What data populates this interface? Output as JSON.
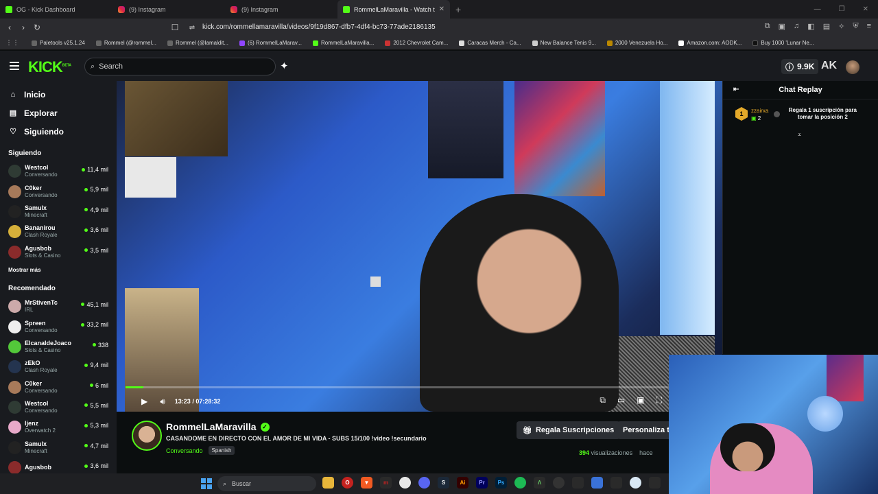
{
  "browser": {
    "tabs": [
      {
        "title": "OG - Kick Dashboard",
        "icon": "kick-icon"
      },
      {
        "title": "(9) Instagram",
        "icon": "instagram-icon"
      },
      {
        "title": "(9) Instagram",
        "icon": "instagram-icon"
      },
      {
        "title": "RommelLaMaravilla - Watch the",
        "icon": "kick-icon",
        "active": true
      }
    ],
    "url": "kick.com/rommellamaravilla/videos/9f19d867-dfb7-4df4-bc73-77ade2186135",
    "bookmarks": [
      "Paletools v25.1.24",
      "Rommel (@rommel...",
      "Rommel (@lamaldit...",
      "(6) RommelLaMarav...",
      "RommelLaMaravilla...",
      "2012 Chevrolet Cam...",
      "Caracas Merch - Ca...",
      "New Balance Tenis 9...",
      "2000 Venezuela Ho...",
      "Amazon.com: AODK...",
      "Buy 1000 'Lunar Ne..."
    ]
  },
  "header": {
    "logo": "KICK",
    "logo_beta": "BETA",
    "search_placeholder": "Search",
    "credits": "9.9K",
    "ak": "AK"
  },
  "sidebar": {
    "nav": [
      {
        "label": "Inicio",
        "icon": "home-icon"
      },
      {
        "label": "Explorar",
        "icon": "explore-icon"
      },
      {
        "label": "Siguiendo",
        "icon": "heart-icon"
      }
    ],
    "following_title": "Siguiendo",
    "following": [
      {
        "name": "Westcol",
        "category": "Conversando",
        "viewers": "11,4 mil",
        "color": "#2f3b34"
      },
      {
        "name": "C0ker",
        "category": "Conversando",
        "viewers": "5,9 mil",
        "color": "#a77a5a"
      },
      {
        "name": "Samulx",
        "category": "Minecraft",
        "viewers": "4,9 mil",
        "color": "#222"
      },
      {
        "name": "Bananirou",
        "category": "Clash Royale",
        "viewers": "3,6 mil",
        "color": "#d6b03a"
      },
      {
        "name": "Agusbob",
        "category": "Slots & Casino",
        "viewers": "3,5 mil",
        "color": "#8a2b2b"
      }
    ],
    "show_more": "Mostrar más",
    "recommended_title": "Recomendado",
    "recommended": [
      {
        "name": "MrStivenTc",
        "category": "IRL",
        "viewers": "45,1 mil",
        "color": "#caa"
      },
      {
        "name": "Spreen",
        "category": "Conversando",
        "viewers": "33,2 mil",
        "color": "#eee"
      },
      {
        "name": "ElcanaldeJoaco",
        "category": "Slots & Casino",
        "viewers": "338",
        "color": "#53c83a"
      },
      {
        "name": "zEkO",
        "category": "Clash Royale",
        "viewers": "9,4 mil",
        "color": "#24344f"
      },
      {
        "name": "C0ker",
        "category": "Conversando",
        "viewers": "6 mil",
        "color": "#a77a5a"
      },
      {
        "name": "Westcol",
        "category": "Conversando",
        "viewers": "5,5 mil",
        "color": "#2f3b34"
      },
      {
        "name": "ljenz",
        "category": "Overwatch 2",
        "viewers": "5,3 mil",
        "color": "#e7a9c9"
      },
      {
        "name": "Samulx",
        "category": "Minecraft",
        "viewers": "4,7 mil",
        "color": "#222"
      },
      {
        "name": "Agusbob",
        "category": "",
        "viewers": "3,6 mil",
        "color": "#8a2b2b"
      }
    ]
  },
  "player": {
    "current_time": "13:23",
    "separator": "/",
    "duration": "07:28:32",
    "progress": 0.0298
  },
  "stream": {
    "streamer": "RommelLaMaravilla",
    "title": "CASANDOME EN DIRECTO CON EL AMOR DE MI VIDA - SUBS 15/100 !video !secundario",
    "category": "Conversando",
    "language": "Spanish",
    "gift_button": "Regala Suscripciones",
    "personalize_button": "Personaliza t",
    "views_count": "394",
    "views_label": "visualizaciones",
    "ago": "hace"
  },
  "chat": {
    "title": "Chat Replay",
    "pinned_user": "zzairxa",
    "pinned_count": "2",
    "pinned_rank": "1",
    "pinned_message": "Regala 1 suscripción para tomar la posición 2"
  },
  "taskbar": {
    "search_placeholder": "Buscar"
  }
}
